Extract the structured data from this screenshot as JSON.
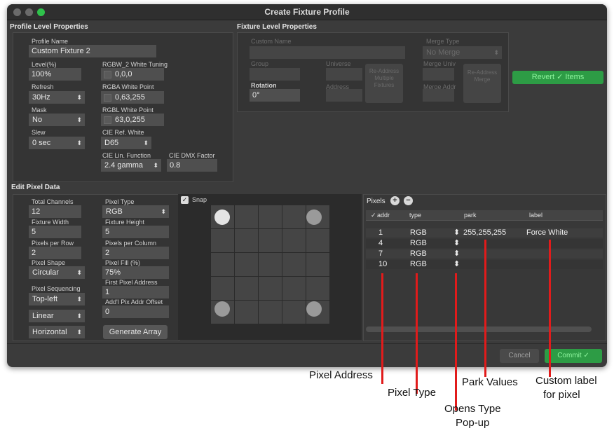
{
  "window": {
    "title": "Create Fixture Profile"
  },
  "profile": {
    "section_title": "Profile Level Properties",
    "name_label": "Profile Name",
    "name_value": "Custom Fixture 2",
    "level_label": "Level(%)",
    "level_value": "100%",
    "refresh_label": "Refresh",
    "refresh_value": "30Hz",
    "mask_label": "Mask",
    "mask_value": "No",
    "slew_label": "Slew",
    "slew_value": "0 sec",
    "rgbw_label": "RGBW_2 White Tuning",
    "rgbw_value": "0,0,0",
    "rgba_label": "RGBA White Point",
    "rgba_value": "0,63,255",
    "rgbl_label": "RGBL White Point",
    "rgbl_value": "63,0,255",
    "cie_ref_label": "CIE Ref. White",
    "cie_ref_value": "D65",
    "cie_lin_label": "CIE Lin. Function",
    "cie_lin_value": "2.4 gamma",
    "cie_dmx_label": "CIE DMX Factor",
    "cie_dmx_value": "0.8"
  },
  "fixture": {
    "section_title": "Fixture Level Properties",
    "custom_name_label": "Custom Name",
    "group_label": "Group",
    "universe_label": "Universe",
    "address_label": "Address",
    "rotation_label": "Rotation",
    "rotation_value": "0°",
    "readdress_button": "Re-Address Multiple Fixtures",
    "merge_type_label": "Merge Type",
    "merge_type_value": "No Merge",
    "merge_univ_label": "Merge Univ",
    "merge_addr_label": "Merge Addr",
    "readdress_merge_button": "Re-Address Merge"
  },
  "revert_button": "Revert ✓ Items",
  "pixel": {
    "section_title": "Edit Pixel Data",
    "total_channels_label": "Total Channels",
    "total_channels_value": "12",
    "fixture_width_label": "Fixture Width",
    "fixture_width_value": "5",
    "pixels_per_row_label": "Pixels per Row",
    "pixels_per_row_value": "2",
    "pixel_shape_label": "Pixel Shape",
    "pixel_shape_value": "Circular",
    "pixel_sequencing_label": "Pixel Sequencing",
    "seq_start_value": "Top-left",
    "seq_mode_value": "Linear",
    "seq_dir_value": "Horizontal",
    "pixel_type_label": "Pixel Type",
    "pixel_type_value": "RGB",
    "fixture_height_label": "Fixture Height",
    "fixture_height_value": "5",
    "pixels_per_column_label": "Pixels per Column",
    "pixels_per_column_value": "2",
    "pixel_fill_label": "Pixel Fill (%)",
    "pixel_fill_value": "75%",
    "first_pixel_address_label": "First Pixel Address",
    "first_pixel_address_value": "1",
    "addl_offset_label": "Add'l Pix Addr Offset",
    "addl_offset_value": "0",
    "generate_button": "Generate Array",
    "snap_label": "Snap"
  },
  "pixels_table": {
    "title": "Pixels",
    "headers": {
      "check": "✓",
      "addr": "addr",
      "type": "type",
      "park": "park",
      "label": "label"
    },
    "rows": [
      {
        "addr": "1",
        "type": "RGB",
        "park": "255,255,255",
        "label": "Force White"
      },
      {
        "addr": "4",
        "type": "RGB",
        "park": "",
        "label": ""
      },
      {
        "addr": "7",
        "type": "RGB",
        "park": "",
        "label": ""
      },
      {
        "addr": "10",
        "type": "RGB",
        "park": "",
        "label": ""
      }
    ]
  },
  "footer": {
    "cancel": "Cancel",
    "commit": "Commit ✓"
  },
  "annotations": {
    "pixel_address": "Pixel Address",
    "pixel_type": "Pixel Type",
    "opens_type_line1": "Opens Type",
    "opens_type_line2": "Pop-up",
    "park_values": "Park Values",
    "custom_label_line1": "Custom label",
    "custom_label_line2": "for pixel"
  },
  "colors": {
    "accent_green": "#2d9c45",
    "annotation_line": "#e11b1b",
    "traffic_close": "#6b6b6b",
    "traffic_zoom": "#2fc14b"
  }
}
